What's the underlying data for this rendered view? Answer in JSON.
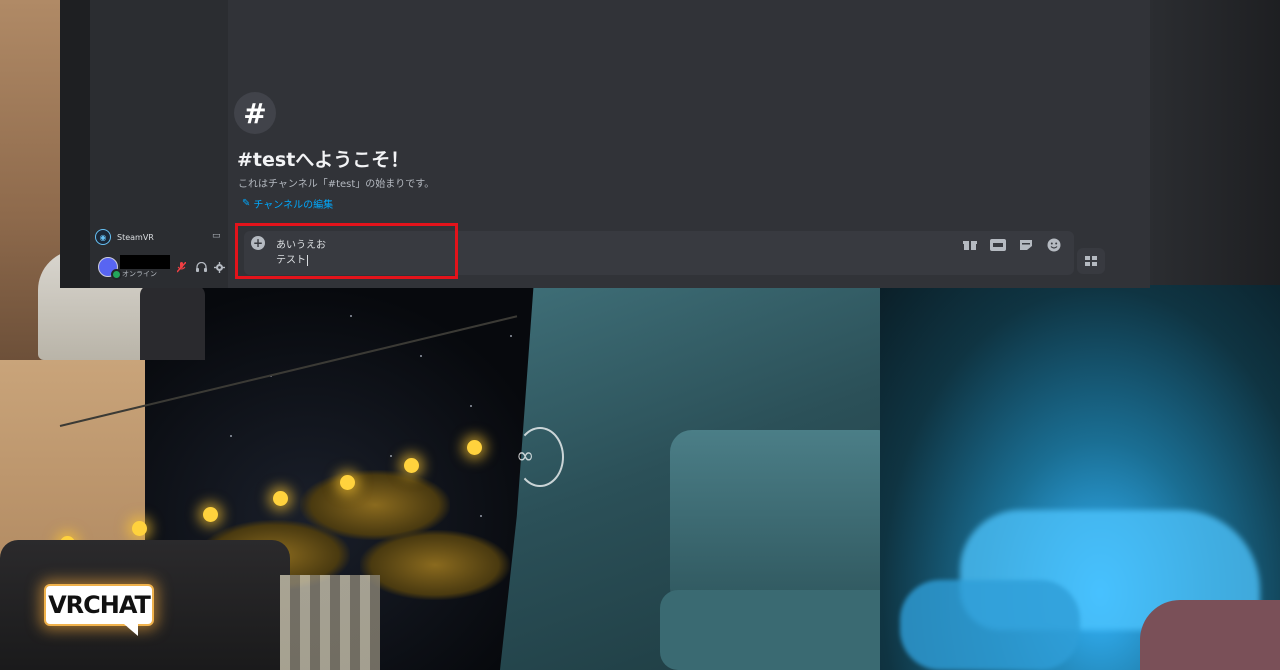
{
  "channel": {
    "hash_symbol": "#",
    "welcome_title": "#testへようこそ！",
    "welcome_subtitle": "これはチャンネル「#test」の始まりです。",
    "edit_link": "チャンネルの編集"
  },
  "composer": {
    "add_symbol": "+",
    "line1": "あいうえお",
    "line2": "テスト",
    "icons": [
      "gift-icon",
      "gif-icon",
      "sticker-icon",
      "emoji-icon"
    ],
    "apps_icon": "apps-icon"
  },
  "streaming": {
    "app_name": "SteamVR"
  },
  "user": {
    "status": "オンライン"
  },
  "world": {
    "logo_text": "VRCHAT",
    "meta_glyph": "∞"
  },
  "colors": {
    "highlight": "#e3131b",
    "link": "#00a8fc",
    "online": "#23a55a",
    "muted": "#f23f43"
  }
}
